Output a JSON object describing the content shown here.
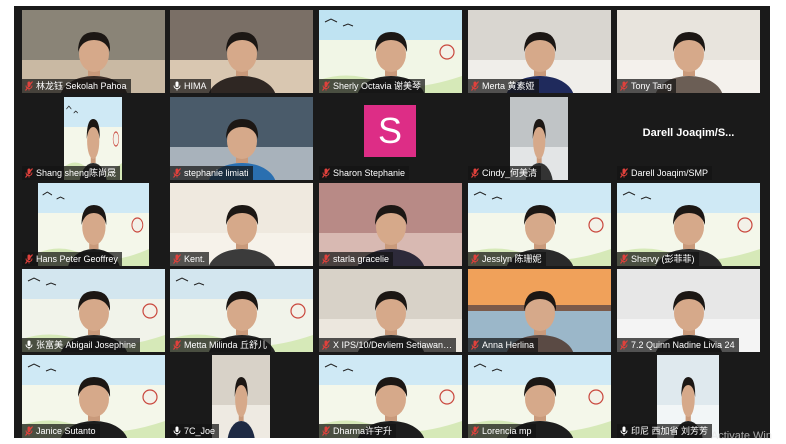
{
  "participants": [
    {
      "name": "林龙钰 Sekolah Pahoa",
      "muted": true
    },
    {
      "name": "HIMA",
      "muted": false,
      "active": true
    },
    {
      "name": "Sherly Octavia 谢美琴",
      "muted": true
    },
    {
      "name": "Merta 黄素娅",
      "muted": true
    },
    {
      "name": "Tony Tang",
      "muted": true
    },
    {
      "name": "Shang sheng陈尚晟",
      "muted": true
    },
    {
      "name": "stephanie limiati",
      "muted": true
    },
    {
      "name": "Sharon Stephanie",
      "muted": true,
      "avatar_letter": "S"
    },
    {
      "name": "Cindy_何美清",
      "muted": true
    },
    {
      "name": "Darell Joaqim/SMP",
      "muted": true,
      "big_name": "Darell Joaqim/S..."
    },
    {
      "name": "Hans Peter Geoffrey",
      "muted": true
    },
    {
      "name": "Kent.",
      "muted": true
    },
    {
      "name": "starla gracelie",
      "muted": true
    },
    {
      "name": "Jesslyn 陈珊妮",
      "muted": true
    },
    {
      "name": "Shervy (彭菲菲)",
      "muted": true
    },
    {
      "name": "张富美 Abigail Josephine",
      "muted": false
    },
    {
      "name": "Metta Milinda 丘舒儿",
      "muted": true
    },
    {
      "name": "X IPS/10/Devliem Setiawan ...",
      "muted": true
    },
    {
      "name": "Anna Herlina",
      "muted": true
    },
    {
      "name": "7.2 Quinn Nadine Livia 24",
      "muted": true
    },
    {
      "name": "Janice Sutanto",
      "muted": true
    },
    {
      "name": "7C_Joe",
      "muted": false
    },
    {
      "name": "Dharma许宇升",
      "muted": true
    },
    {
      "name": "Lorencia mp",
      "muted": true
    },
    {
      "name": "印尼 西加省 刘芳芳",
      "muted": false
    }
  ],
  "watermark": "Activate Win",
  "colors": {
    "active_speaker": "#d7e84a",
    "muted_icon": "#e0413c",
    "avatar_bg": "#dd2d86"
  }
}
